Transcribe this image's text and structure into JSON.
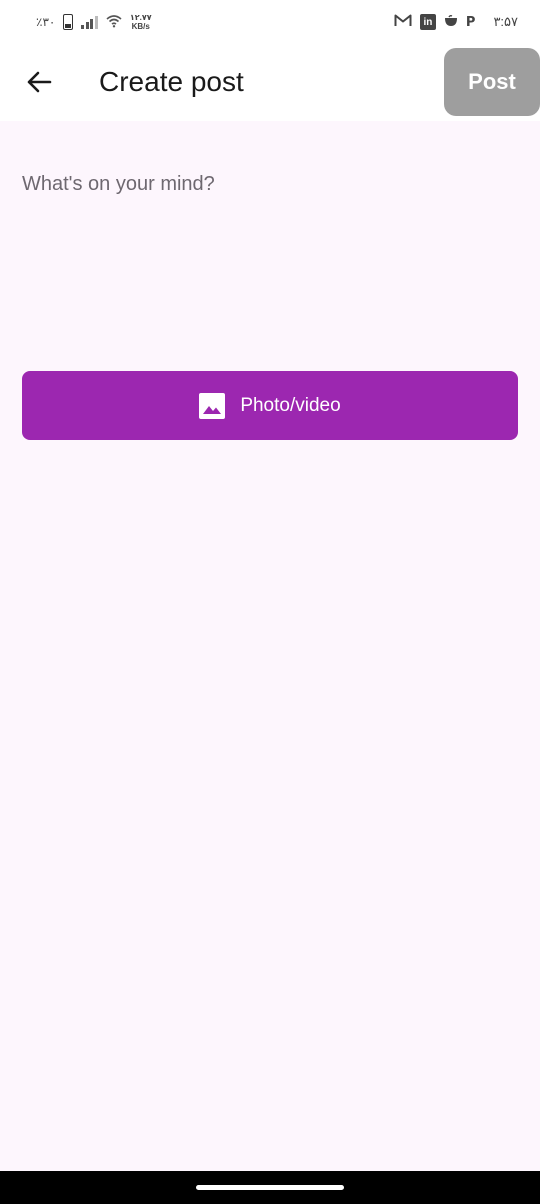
{
  "status_bar": {
    "battery_percent": "٪۳۰",
    "network_speed_value": "۱۲.۷۷",
    "network_speed_unit": "KB/s",
    "notification_icons": [
      "gmail-icon",
      "linkedin-icon",
      "cup-icon",
      "p-icon"
    ],
    "time": "۳:۵۷"
  },
  "app_bar": {
    "title": "Create post",
    "post_label": "Post",
    "post_button_color": "#9e9e9e"
  },
  "composer": {
    "value": "",
    "placeholder": "What's on your mind?"
  },
  "media_button": {
    "label": "Photo/video",
    "color": "#9c27b0",
    "icon": "image-icon"
  }
}
